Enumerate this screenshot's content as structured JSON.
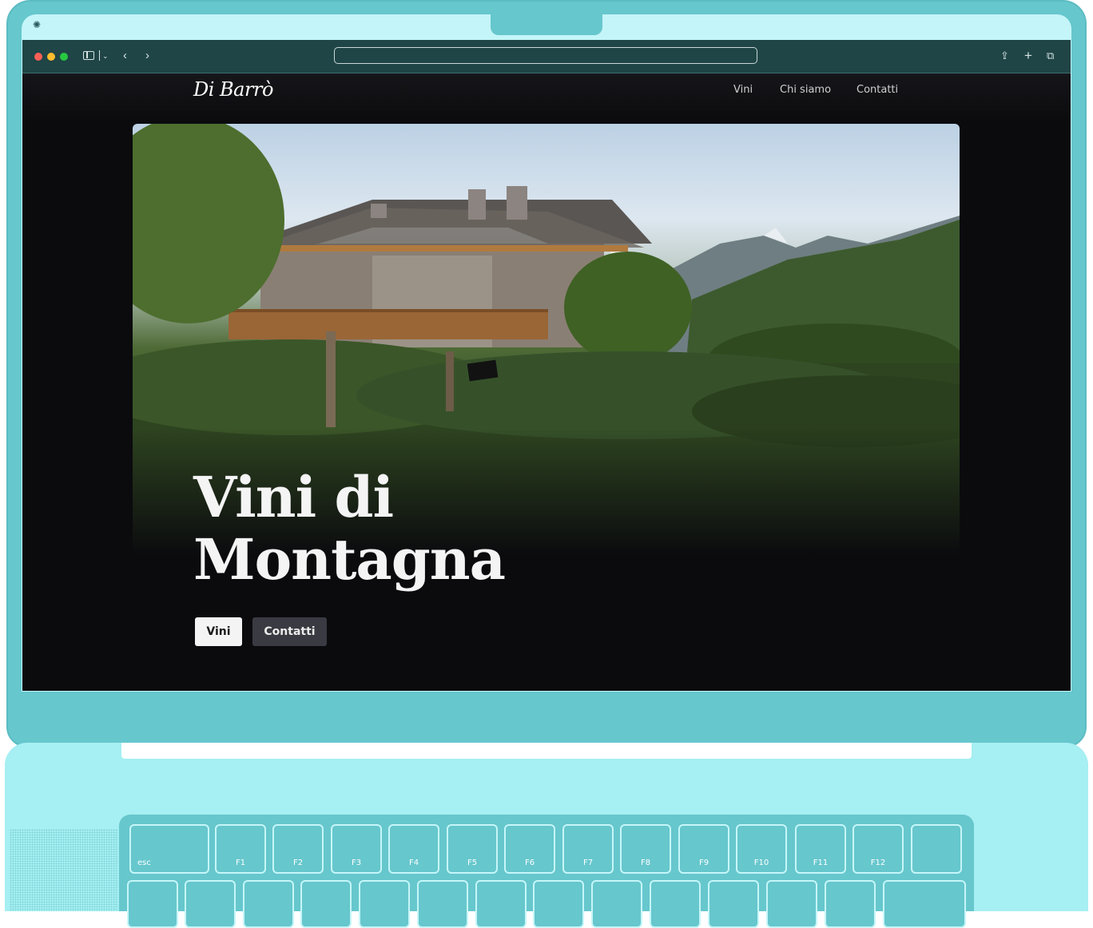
{
  "browser": {
    "url": ""
  },
  "site": {
    "logo_text": "Di Barrò",
    "nav": [
      {
        "label": "Vini"
      },
      {
        "label": "Chi siamo"
      },
      {
        "label": "Contatti"
      }
    ],
    "hero": {
      "title_line1": "Vini di",
      "title_line2": "Montagna",
      "primary_button": "Vini",
      "secondary_button": "Contatti"
    }
  },
  "keyboard": {
    "function_row": [
      "esc",
      "F1",
      "F2",
      "F3",
      "F4",
      "F5",
      "F6",
      "F7",
      "F8",
      "F9",
      "F10",
      "F11",
      "F12",
      ""
    ]
  },
  "colors": {
    "laptop_body": "#66c7cd",
    "laptop_base": "#a6eff2",
    "toolbar": "#1f4546",
    "site_background": "#0b0b0e",
    "button_primary": "#f4f4f4",
    "button_secondary": "#3a3a42"
  }
}
